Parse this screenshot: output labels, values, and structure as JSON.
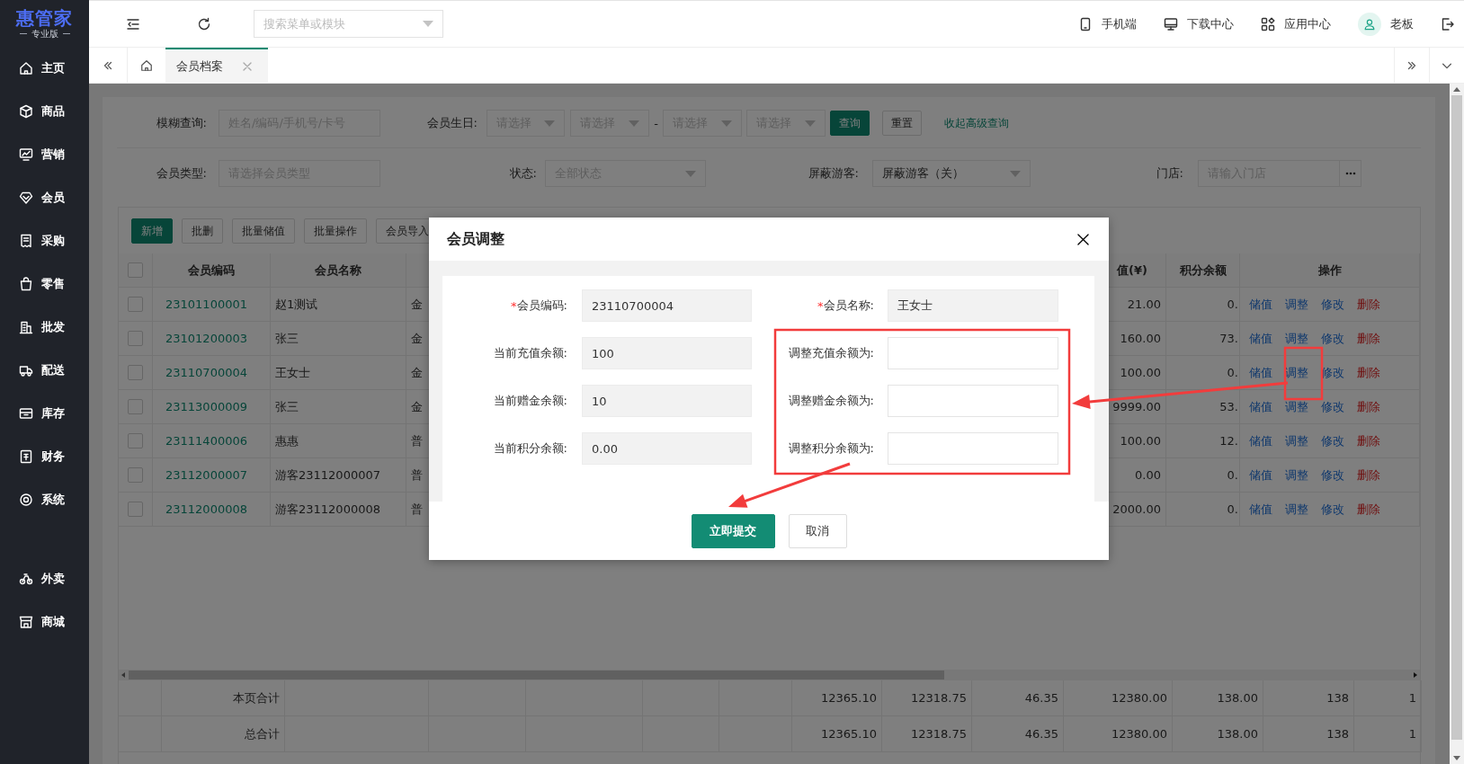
{
  "sidebar": {
    "logo": "惠管家",
    "edition": "专业版",
    "items": [
      {
        "label": "主页"
      },
      {
        "label": "商品"
      },
      {
        "label": "营销"
      },
      {
        "label": "会员"
      },
      {
        "label": "采购"
      },
      {
        "label": "零售"
      },
      {
        "label": "批发"
      },
      {
        "label": "配送"
      },
      {
        "label": "库存"
      },
      {
        "label": "财务"
      },
      {
        "label": "系统"
      }
    ],
    "extra_items": [
      {
        "label": "外卖"
      },
      {
        "label": "商城"
      }
    ]
  },
  "header": {
    "search_placeholder": "搜索菜单或模块",
    "links": [
      "手机端",
      "下载中心",
      "应用中心"
    ],
    "user": "老板"
  },
  "tabs": [
    {
      "label": "会员档案",
      "selected": true
    }
  ],
  "filters": [
    [
      {
        "kind": "label",
        "text": "模糊查询:"
      },
      {
        "kind": "input",
        "placeholder": "姓名/编码/手机号/卡号"
      },
      {
        "kind": "label",
        "text": "会员生日:"
      },
      {
        "kind": "select",
        "placeholder": "请选择"
      },
      {
        "kind": "select",
        "placeholder": "请选择"
      },
      {
        "kind": "text",
        "text": "-"
      },
      {
        "kind": "select",
        "placeholder": "请选择"
      },
      {
        "kind": "select",
        "placeholder": "请选择"
      },
      {
        "kind": "primary",
        "text": "查询"
      },
      {
        "kind": "button",
        "text": "重置"
      },
      {
        "kind": "link",
        "text": "收起高级查询"
      }
    ],
    [
      {
        "kind": "label",
        "text": "会员类型:"
      },
      {
        "kind": "input",
        "placeholder": "请选择会员类型"
      },
      {
        "kind": "label",
        "text": "状态:"
      },
      {
        "kind": "select",
        "placeholder": "全部状态"
      },
      {
        "kind": "label",
        "text": "屏蔽游客:"
      },
      {
        "kind": "select",
        "value": "屏蔽游客（关）"
      },
      {
        "kind": "label",
        "text": "门店:"
      },
      {
        "kind": "picker",
        "placeholder": "请输入门店"
      }
    ]
  ],
  "toolbar": [
    {
      "label": "新增",
      "kind": "primary"
    },
    {
      "label": "批删",
      "kind": "button"
    },
    {
      "label": "批量储值",
      "kind": "button"
    },
    {
      "label": "批量操作",
      "kind": "button"
    },
    {
      "label": "会员导入",
      "kind": "button"
    }
  ],
  "table": {
    "all_checked": false,
    "columns": [
      "会员编码",
      "会员名称",
      "值(¥)",
      "积分余额",
      "操作"
    ],
    "rows": [
      {
        "checked": false,
        "code": "23101100001",
        "name": "赵1测试",
        "column_4": "金",
        "stored_value": "21.00",
        "points": "0.",
        "actions": [
          {
            "label": "储值",
            "kind": "link"
          },
          {
            "label": "调整",
            "kind": "link"
          },
          {
            "label": "修改",
            "kind": "link"
          },
          {
            "label": "删除",
            "kind": "danger"
          }
        ]
      },
      {
        "checked": false,
        "code": "23101200003",
        "name": "张三",
        "column_4": "金",
        "stored_value": "160.00",
        "points": "73.",
        "actions": [
          {
            "label": "储值",
            "kind": "link"
          },
          {
            "label": "调整",
            "kind": "link"
          },
          {
            "label": "修改",
            "kind": "link"
          },
          {
            "label": "删除",
            "kind": "danger"
          }
        ]
      },
      {
        "checked": false,
        "code": "23110700004",
        "name": "王女士",
        "column_4": "金",
        "stored_value": "100.00",
        "points": "0.",
        "actions": [
          {
            "label": "储值",
            "kind": "link"
          },
          {
            "label": "调整",
            "kind": "link"
          },
          {
            "label": "修改",
            "kind": "link"
          },
          {
            "label": "删除",
            "kind": "danger"
          }
        ]
      },
      {
        "checked": false,
        "code": "23113000009",
        "name": "张三",
        "column_4": "金",
        "stored_value": "9999.00",
        "points": "53.",
        "actions": [
          {
            "label": "储值",
            "kind": "link"
          },
          {
            "label": "调整",
            "kind": "link"
          },
          {
            "label": "修改",
            "kind": "link"
          },
          {
            "label": "删除",
            "kind": "danger"
          }
        ]
      },
      {
        "checked": false,
        "code": "23111400006",
        "name": "惠惠",
        "column_4": "普",
        "stored_value": "100.00",
        "points": "12.",
        "actions": [
          {
            "label": "储值",
            "kind": "link"
          },
          {
            "label": "调整",
            "kind": "link"
          },
          {
            "label": "修改",
            "kind": "link"
          },
          {
            "label": "删除",
            "kind": "danger"
          }
        ]
      },
      {
        "checked": false,
        "code": "23112000007",
        "name": "游客23112000007",
        "column_4": "普",
        "stored_value": "0.00",
        "points": "0.",
        "actions": [
          {
            "label": "储值",
            "kind": "link"
          },
          {
            "label": "调整",
            "kind": "link"
          },
          {
            "label": "修改",
            "kind": "link"
          },
          {
            "label": "删除",
            "kind": "danger"
          }
        ]
      },
      {
        "checked": false,
        "code": "23112000008",
        "name": "游客23112000008",
        "column_4": "普",
        "stored_value": "2000.00",
        "points": "0.",
        "actions": [
          {
            "label": "储值",
            "kind": "link"
          },
          {
            "label": "调整",
            "kind": "link"
          },
          {
            "label": "修改",
            "kind": "link"
          },
          {
            "label": "删除",
            "kind": "danger"
          }
        ]
      }
    ],
    "totals": [
      {
        "label": "本页合计",
        "values": [
          "12365.10",
          "12318.75",
          "46.35",
          "12380.00",
          "138.00",
          "138",
          "1"
        ]
      },
      {
        "label": "总合计",
        "values": [
          "12365.10",
          "12318.75",
          "46.35",
          "12380.00",
          "138.00",
          "138",
          "1"
        ]
      }
    ]
  },
  "dialog": {
    "title": "会员调整",
    "fields": [
      {
        "required_mark": "*",
        "label": "会员编码:",
        "value": "23110700004",
        "readonly": true
      },
      {
        "required_mark": "*",
        "label": "会员名称:",
        "value": "王女士",
        "readonly": true
      },
      {
        "label": "当前充值余额:",
        "value": "100",
        "readonly": true
      },
      {
        "label": "调整充值余额为:",
        "readonly": false
      },
      {
        "label": "当前赠金余额:",
        "value": "10",
        "readonly": true
      },
      {
        "label": "调整赠金余额为:",
        "readonly": false
      },
      {
        "label": "当前积分余额:",
        "value": "0.00",
        "readonly": true
      },
      {
        "label": "调整积分余额为:",
        "readonly": false
      }
    ],
    "buttons": [
      {
        "label": "立即提交",
        "kind": "primary"
      },
      {
        "label": "取消",
        "kind": "button"
      }
    ]
  }
}
